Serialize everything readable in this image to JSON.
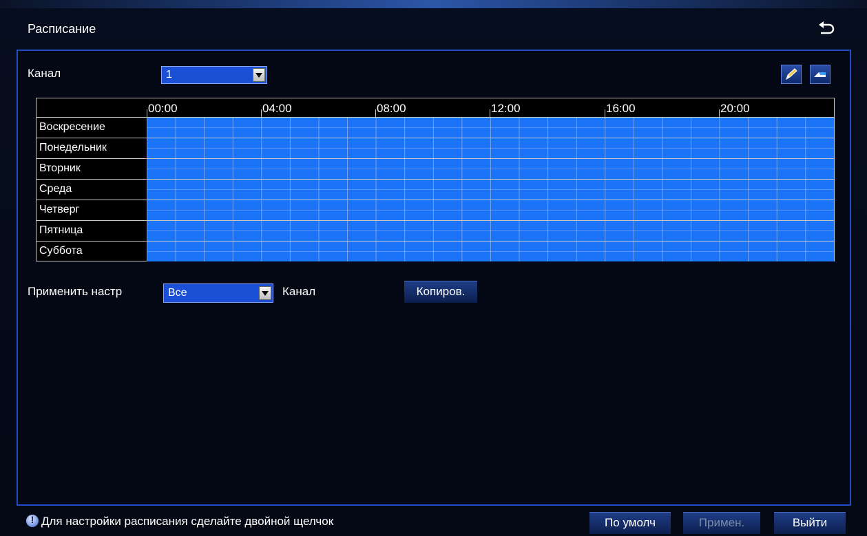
{
  "window": {
    "title": "Расписание",
    "back_icon": "undo-arrow-icon"
  },
  "channel": {
    "label": "Канал",
    "selected": "1"
  },
  "tools": {
    "edit_icon": "pencil-icon",
    "erase_icon": "eraser-icon"
  },
  "schedule": {
    "hours": [
      "00:00",
      "04:00",
      "08:00",
      "12:00",
      "16:00",
      "20:00"
    ],
    "days": [
      "Воскресение",
      "Понедельник",
      "Вторник",
      "Среда",
      "Четверг",
      "Пятница",
      "Суббота"
    ],
    "active_color": "#1b74f7"
  },
  "apply": {
    "label": "Применить настр",
    "selected": "Все",
    "channel_label": "Канал",
    "copy_button": "Копиров."
  },
  "footer": {
    "hint": "Для настройки расписания сделайте двойной щелчок",
    "default_button": "По умолч",
    "apply_button": "Примен.",
    "exit_button": "Выйти"
  }
}
